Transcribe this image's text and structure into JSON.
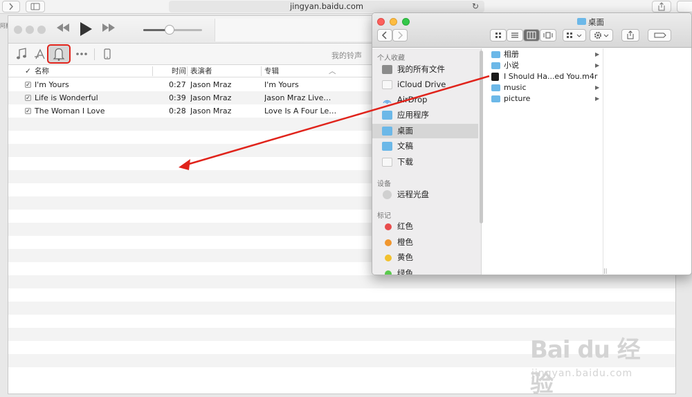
{
  "browser": {
    "url": "jingyan.baidu.com",
    "left_edge_text": "阿翻"
  },
  "itunes": {
    "ringtones_title": "我的铃声",
    "columns": {
      "name": "名称",
      "time": "时间",
      "artist": "表演者",
      "album": "专辑"
    },
    "songs": [
      {
        "checked": "✓",
        "name": "I'm Yours",
        "time": "0:27",
        "artist": "Jason Mraz",
        "album": "I'm Yours"
      },
      {
        "checked": "✓",
        "name": "Life is Wonderful",
        "time": "0:39",
        "artist": "Jason Mraz",
        "album": "Jason Mraz Live…"
      },
      {
        "checked": "✓",
        "name": "The Woman I Love",
        "time": "0:28",
        "artist": "Jason Mraz",
        "album": "Love Is A Four Le…"
      }
    ],
    "volume_level": 0.45
  },
  "finder": {
    "title": "桌面",
    "sidebar": {
      "favorites_heading": "个人收藏",
      "favorites": [
        {
          "label": "我的所有文件",
          "icon": "all-files-icon"
        },
        {
          "label": "iCloud Drive",
          "icon": "icloud-icon"
        },
        {
          "label": "AirDrop",
          "icon": "airdrop-icon"
        },
        {
          "label": "应用程序",
          "icon": "applications-icon"
        },
        {
          "label": "桌面",
          "icon": "desktop-icon",
          "selected": true
        },
        {
          "label": "文稿",
          "icon": "documents-icon"
        },
        {
          "label": "下载",
          "icon": "downloads-icon"
        }
      ],
      "devices_heading": "设备",
      "devices": [
        {
          "label": "远程光盘",
          "icon": "remote-disc-icon"
        }
      ],
      "tags_heading": "标记",
      "tags": [
        {
          "label": "红色",
          "color": "#e84c4c"
        },
        {
          "label": "橙色",
          "color": "#f0962e"
        },
        {
          "label": "黄色",
          "color": "#f2c12e"
        },
        {
          "label": "绿色",
          "color": "#5ac94d"
        }
      ]
    },
    "items": [
      {
        "name": "相册",
        "type": "folder",
        "has_children": true
      },
      {
        "name": "小说",
        "type": "folder",
        "has_children": true
      },
      {
        "name": "I Should Ha...ed You.m4r",
        "type": "file",
        "has_children": false
      },
      {
        "name": "music",
        "type": "folder",
        "has_children": true
      },
      {
        "name": "picture",
        "type": "folder",
        "has_children": true
      }
    ]
  },
  "watermark": {
    "logo": "Bai du 经验",
    "url": "jingyan.baidu.com"
  },
  "colors": {
    "highlight_red": "#e0231b",
    "folder_blue": "#6cb8e8"
  }
}
